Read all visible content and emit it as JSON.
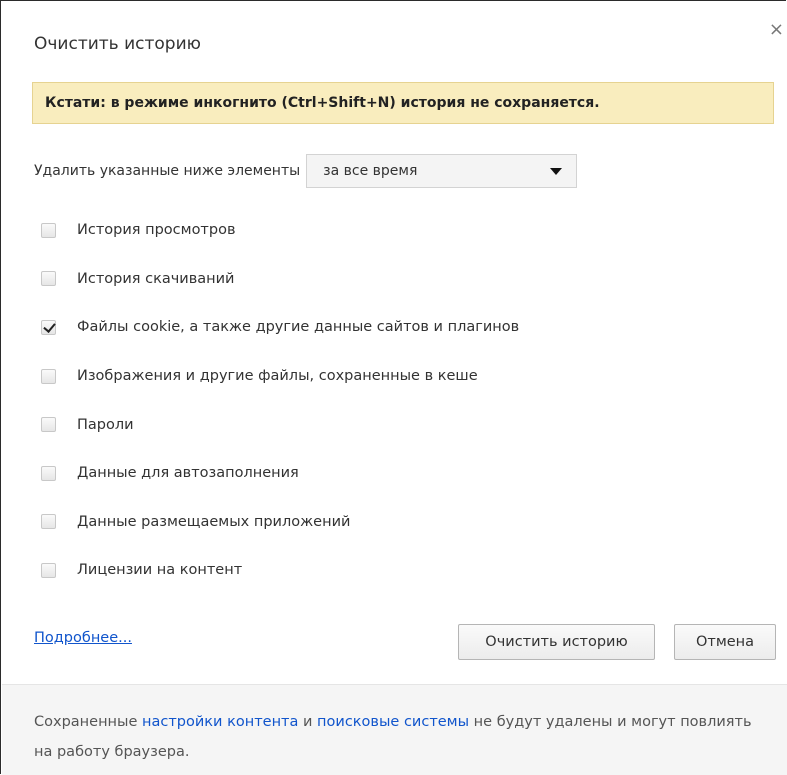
{
  "dialog": {
    "title": "Очистить историю",
    "close_glyph": "×"
  },
  "notice": {
    "text": "Кстати: в режиме инкогнито (Ctrl+Shift+N) история не сохраняется."
  },
  "delete_row": {
    "label": "Удалить указанные ниже элементы",
    "select_value": "за все время"
  },
  "options": [
    {
      "label": "История просмотров",
      "checked": false
    },
    {
      "label": "История скачиваний",
      "checked": false
    },
    {
      "label": "Файлы cookie, а также другие данные сайтов и плагинов",
      "checked": true
    },
    {
      "label": "Изображения и другие файлы, сохраненные в кеше",
      "checked": false
    },
    {
      "label": "Пароли",
      "checked": false
    },
    {
      "label": "Данные для автозаполнения",
      "checked": false
    },
    {
      "label": "Данные размещаемых приложений",
      "checked": false
    },
    {
      "label": "Лицензии на контент",
      "checked": false
    }
  ],
  "actions": {
    "more_link": "Подробнее...",
    "clear_button": "Очистить историю",
    "cancel_button": "Отмена"
  },
  "footer": {
    "text_before": "Сохраненные ",
    "link_content_settings": "настройки контента",
    "text_and": " и ",
    "link_search_engines": "поисковые системы",
    "text_after": " не будут удалены и могут повлиять на работу браузера."
  }
}
